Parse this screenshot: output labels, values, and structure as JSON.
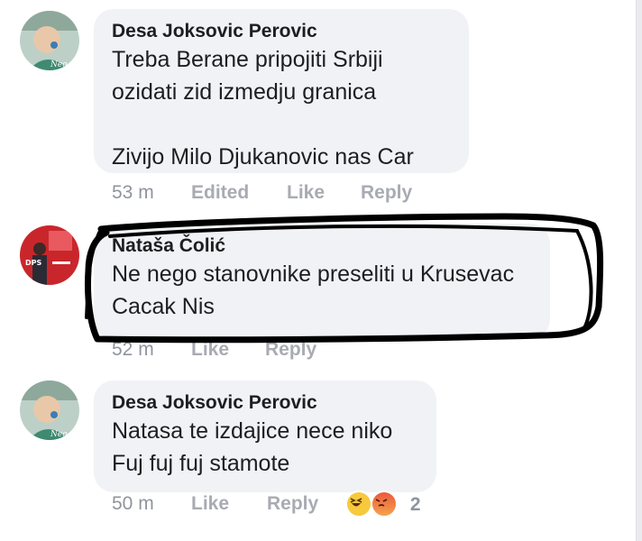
{
  "comments": [
    {
      "author": "Desa Joksovic Perovic",
      "text": "Treba Berane pripojiti Srbiji\nozidati zid  izmedju   granica\n\nZivijo Milo Djukanovic nas Car",
      "time": "53 m",
      "edited": "Edited",
      "like": "Like",
      "reply": "Reply"
    },
    {
      "author": "Nataša Čolić",
      "text": "Ne nego stanovnike preseliti u Krusevac\nCacak Nis",
      "time": "52 m",
      "like": "Like",
      "reply": "Reply"
    },
    {
      "author": "Desa Joksovic Perovic",
      "text": "Natasa te izdajice nece niko\nFuj fuj fuj  stamote",
      "time": "50 m",
      "like": "Like",
      "reply": "Reply",
      "reactions": {
        "types": [
          "haha-icon",
          "angry-icon"
        ],
        "count": "2"
      }
    }
  ],
  "colors": {
    "bubble": "#f1f2f5",
    "meta": "#90949c",
    "scribble": "#000000"
  }
}
